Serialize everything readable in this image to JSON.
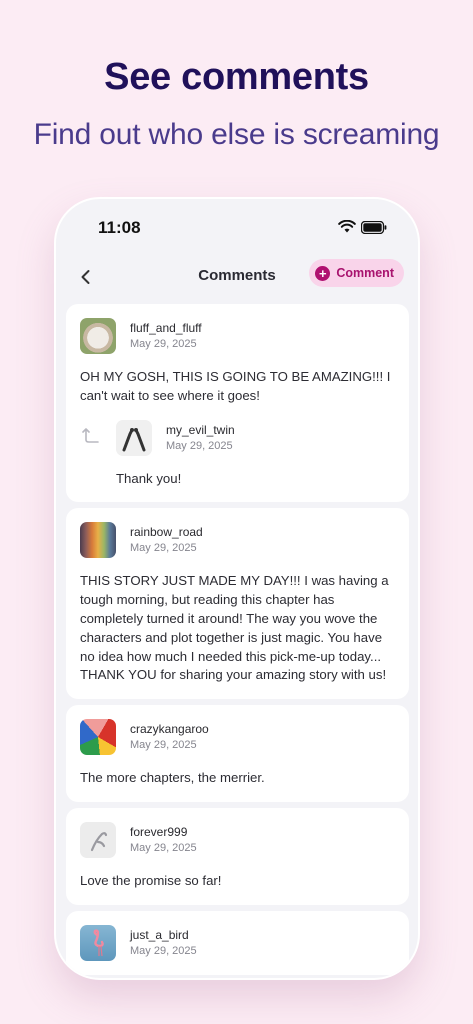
{
  "headline": "See comments",
  "subheadline": "Find out who else is screaming",
  "status_bar": {
    "time": "11:08"
  },
  "nav": {
    "title": "Comments",
    "comment_button_label": "Comment"
  },
  "comments": [
    {
      "username": "fluff_and_fluff",
      "date": "May 29, 2025",
      "text": "OH MY GOSH, THIS IS GOING TO BE AMAZING!!! I can't wait to see where it goes!",
      "reply": {
        "username": "my_evil_twin",
        "date": "May 29, 2025",
        "text": "Thank you!"
      }
    },
    {
      "username": "rainbow_road",
      "date": "May 29, 2025",
      "text": "THIS STORY JUST MADE MY DAY!!! I was having a tough morning, but reading this chapter has completely turned it around! The way you wove the characters and plot together is just magic. You have no idea how much I needed this pick-me-up today... THANK YOU for sharing your amazing story with us!"
    },
    {
      "username": "crazykangaroo",
      "date": "May 29, 2025",
      "text": "The more chapters, the merrier."
    },
    {
      "username": "forever999",
      "date": "May 29, 2025",
      "text": "Love the promise so far!"
    },
    {
      "username": "just_a_bird",
      "date": "May 29, 2025",
      "text": ""
    }
  ]
}
